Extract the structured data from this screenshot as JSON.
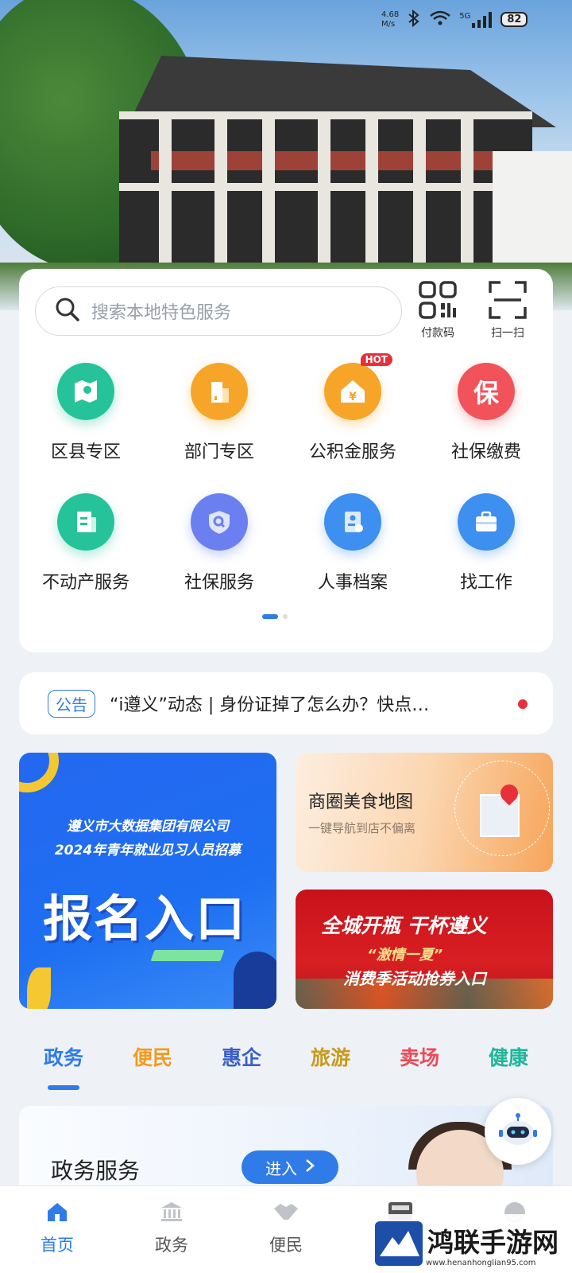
{
  "status_bar": {
    "speed": "4.68",
    "speed_unit": "M/s",
    "network": "5G",
    "battery": "82"
  },
  "search": {
    "placeholder": "搜索本地特色服务"
  },
  "quick_actions": [
    {
      "label": "付款码"
    },
    {
      "label": "扫一扫"
    }
  ],
  "services": [
    {
      "label": "区县专区",
      "color": "#26c39a",
      "icon": "map-icon"
    },
    {
      "label": "部门专区",
      "color": "#f7a528",
      "icon": "building-icon"
    },
    {
      "label": "公积金服务",
      "color": "#f7a528",
      "icon": "house-fund-icon",
      "badge": "HOT"
    },
    {
      "label": "社保缴费",
      "color": "#f2525a",
      "icon": "bao-icon",
      "glyph": "保"
    },
    {
      "label": "不动产服务",
      "color": "#26c39a",
      "icon": "document-icon"
    },
    {
      "label": "社保服务",
      "color": "#6b7ff0",
      "icon": "shield-search-icon"
    },
    {
      "label": "人事档案",
      "color": "#3d8ff0",
      "icon": "profile-file-icon"
    },
    {
      "label": "找工作",
      "color": "#3d8ff0",
      "icon": "briefcase-icon"
    }
  ],
  "notice": {
    "tag": "公告",
    "text": "“i遵义”动态 | 身份证掉了怎么办？快点…"
  },
  "banners": {
    "recruit": {
      "line1": "遵义市大数据集团有限公司",
      "line2": "2024年青年就业见习人员招募",
      "big": "报名入口"
    },
    "food_map": {
      "title": "商圈美食地图",
      "subtitle": "一键导航到店不偏离"
    },
    "campaign": {
      "line1": "全城开瓶 干杯遵义",
      "line2": "“激情一夏”",
      "line3": "消费季活动抢券入口"
    }
  },
  "tabs": [
    {
      "label": "政务",
      "color": "#2f7be8"
    },
    {
      "label": "便民",
      "color": "#f39a1e"
    },
    {
      "label": "惠企",
      "color": "#3b5fc9"
    },
    {
      "label": "旅游",
      "color": "#c99a1a"
    },
    {
      "label": "卖场",
      "color": "#ef4a56"
    },
    {
      "label": "健康",
      "color": "#1fb59a"
    }
  ],
  "gov_card": {
    "title": "政务服务",
    "enter": "进入"
  },
  "bottom_nav": [
    {
      "label": "首页",
      "icon": "home-icon"
    },
    {
      "label": "政务",
      "icon": "government-icon"
    },
    {
      "label": "便民",
      "icon": "handshake-icon"
    },
    {
      "label": "",
      "icon": "news-icon"
    },
    {
      "label": "",
      "icon": "profile-icon"
    }
  ],
  "watermark": {
    "title": "鸿联手游网",
    "url": "www.henanhonglian95.com"
  }
}
